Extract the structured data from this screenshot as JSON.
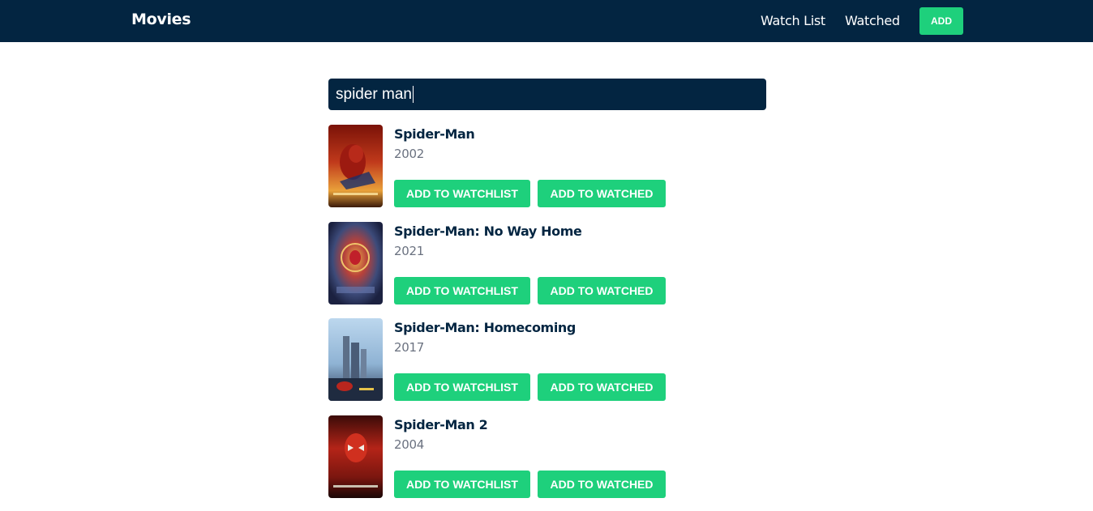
{
  "header": {
    "brand": "Movies",
    "nav": [
      "Watch List",
      "Watched"
    ],
    "add_label": "ADD"
  },
  "search": {
    "value": "spider man"
  },
  "results": [
    {
      "title": "Spider-Man",
      "year": "2002",
      "watchlist_label": "ADD TO WATCHLIST",
      "watched_label": "ADD TO WATCHED"
    },
    {
      "title": "Spider-Man: No Way Home",
      "year": "2021",
      "watchlist_label": "ADD TO WATCHLIST",
      "watched_label": "ADD TO WATCHED"
    },
    {
      "title": "Spider-Man: Homecoming",
      "year": "2017",
      "watchlist_label": "ADD TO WATCHLIST",
      "watched_label": "ADD TO WATCHED"
    },
    {
      "title": "Spider-Man 2",
      "year": "2004",
      "watchlist_label": "ADD TO WATCHLIST",
      "watched_label": "ADD TO WATCHED"
    }
  ],
  "colors": {
    "navy": "#032541",
    "green": "#1ed07c"
  }
}
